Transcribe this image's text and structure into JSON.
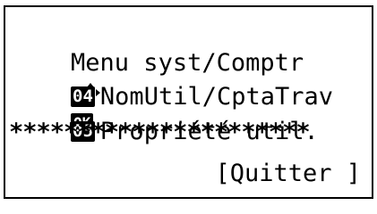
{
  "screen": {
    "title": "Menu syst/Comptr",
    "ok_label": "OK",
    "items": [
      {
        "number": "04",
        "label": "NomUtil/CptaTrav"
      },
      {
        "number": "05",
        "label": "Propriété util."
      }
    ],
    "separator": "**********************",
    "soft_key": "[Quitter ]"
  }
}
